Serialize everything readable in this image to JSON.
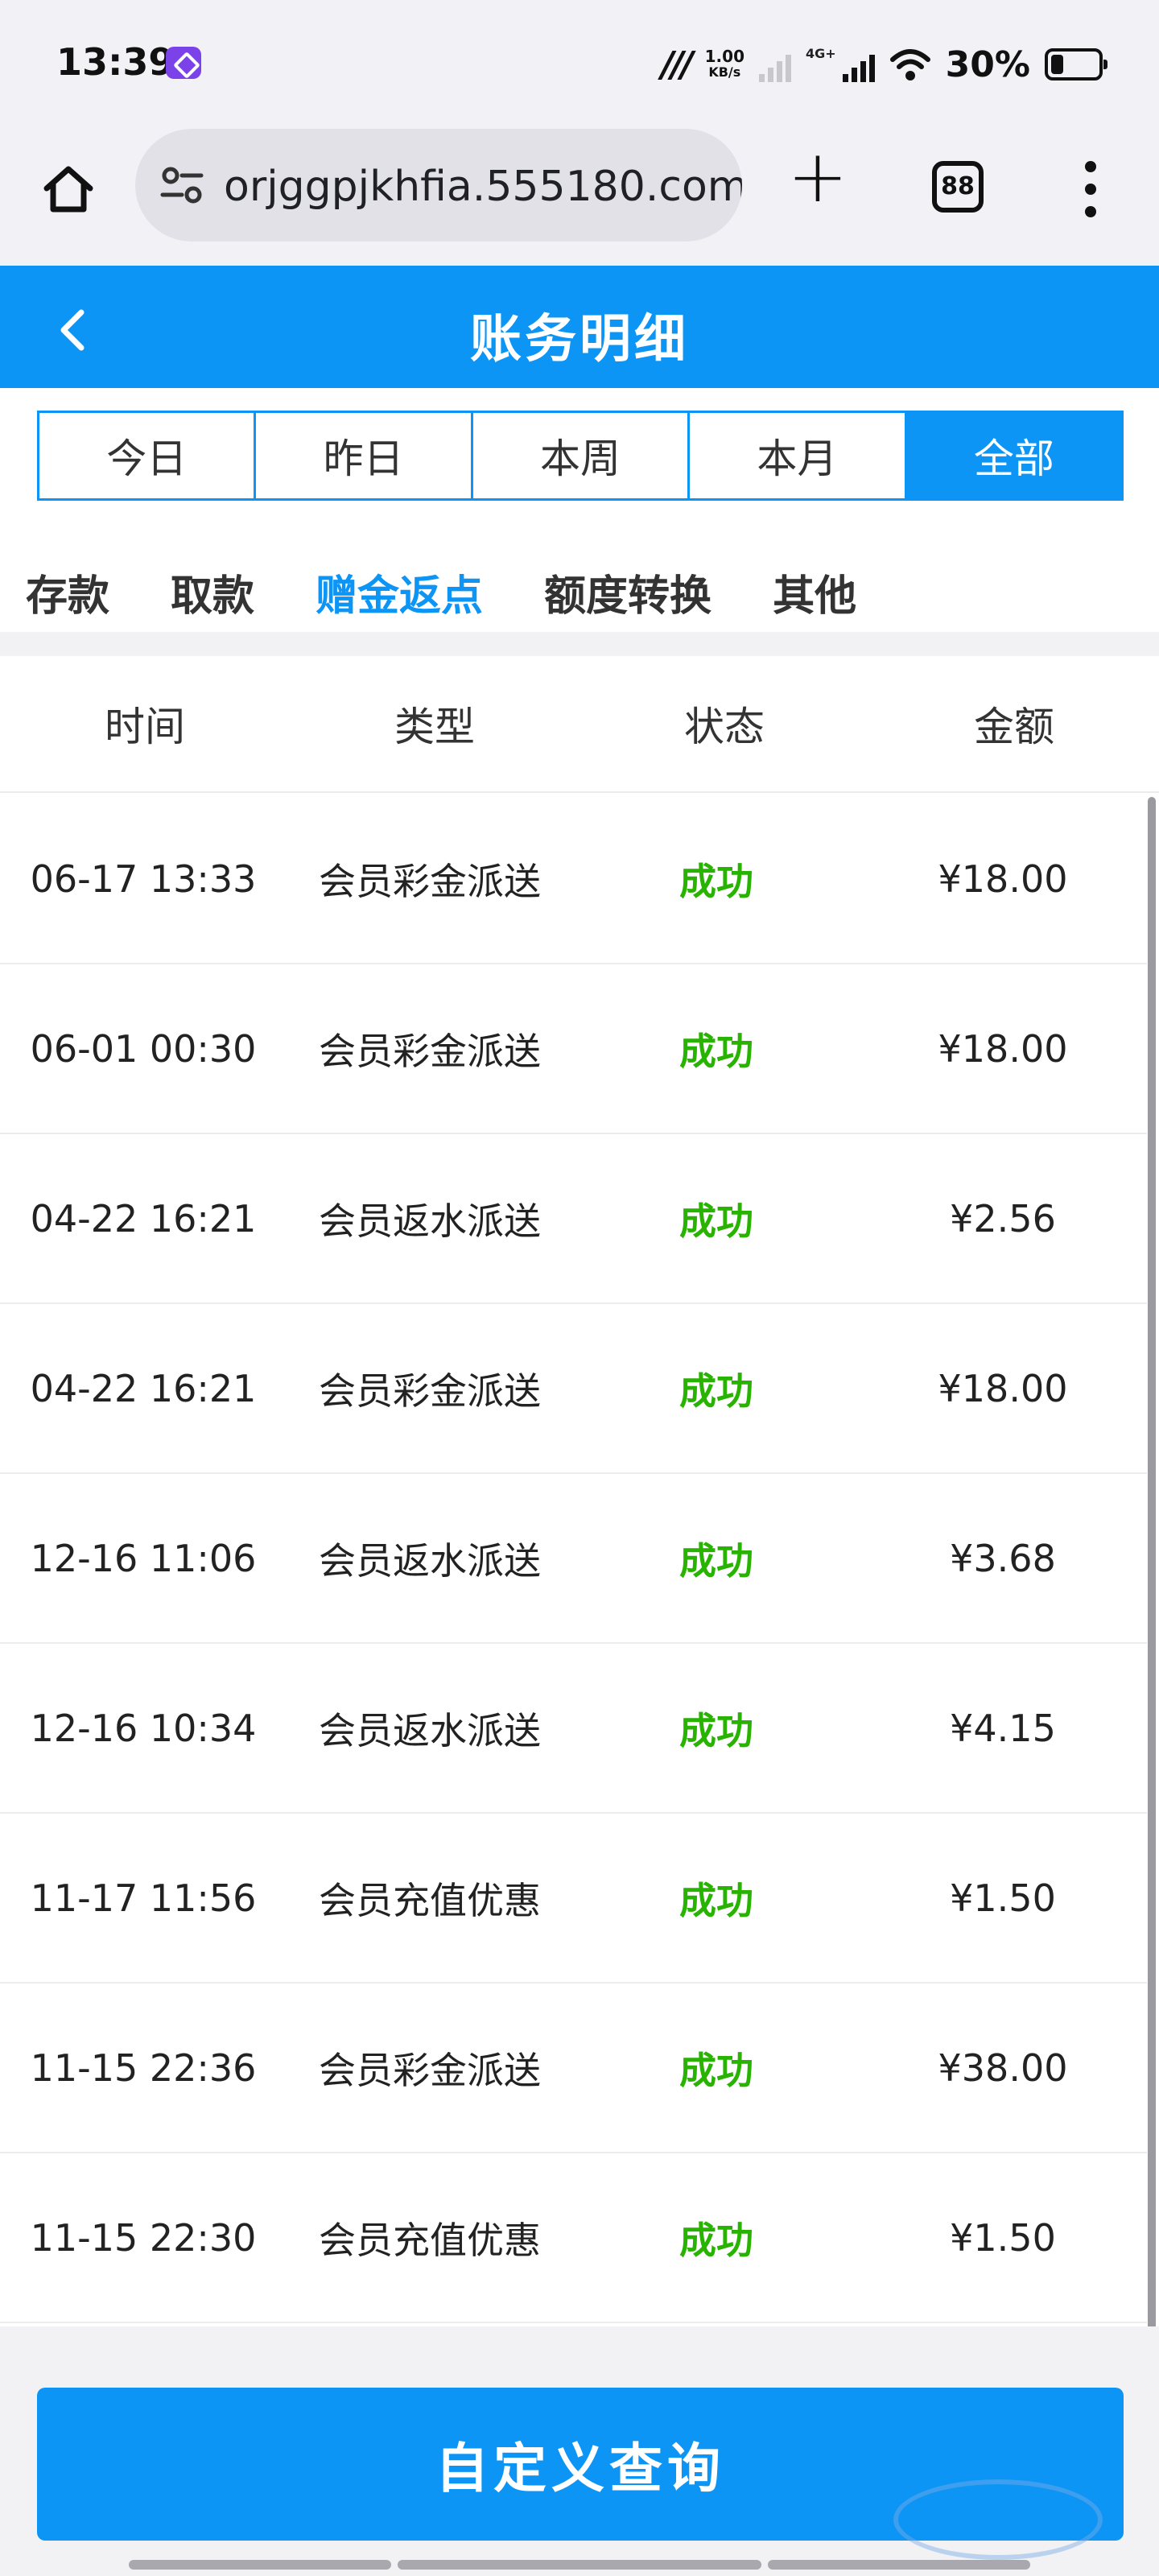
{
  "status_bar": {
    "time": "13:39",
    "app_icon": "shortcut-app-icon",
    "speed_value": "1.00",
    "speed_unit": "KB/s",
    "network_label": "4G+",
    "battery_text": "30%",
    "battery_level": 0.3
  },
  "browser": {
    "url": "orjggpjkhfia.555180.com",
    "tab_count": "88"
  },
  "header": {
    "title": "账务明细"
  },
  "period_tabs": [
    {
      "label": "今日",
      "active": false
    },
    {
      "label": "昨日",
      "active": false
    },
    {
      "label": "本周",
      "active": false
    },
    {
      "label": "本月",
      "active": false
    },
    {
      "label": "全部",
      "active": true
    }
  ],
  "category_tabs": [
    {
      "label": "存款",
      "active": false
    },
    {
      "label": "取款",
      "active": false
    },
    {
      "label": "赠金返点",
      "active": true
    },
    {
      "label": "额度转换",
      "active": false
    },
    {
      "label": "其他",
      "active": false
    }
  ],
  "table": {
    "headers": [
      "时间",
      "类型",
      "状态",
      "金额"
    ],
    "rows": [
      {
        "time": "06-17 13:33",
        "type": "会员彩金派送",
        "status": "成功",
        "amount": "¥18.00"
      },
      {
        "time": "06-01 00:30",
        "type": "会员彩金派送",
        "status": "成功",
        "amount": "¥18.00"
      },
      {
        "time": "04-22 16:21",
        "type": "会员返水派送",
        "status": "成功",
        "amount": "¥2.56"
      },
      {
        "time": "04-22 16:21",
        "type": "会员彩金派送",
        "status": "成功",
        "amount": "¥18.00"
      },
      {
        "time": "12-16 11:06",
        "type": "会员返水派送",
        "status": "成功",
        "amount": "¥3.68"
      },
      {
        "time": "12-16 10:34",
        "type": "会员返水派送",
        "status": "成功",
        "amount": "¥4.15"
      },
      {
        "time": "11-17 11:56",
        "type": "会员充值优惠",
        "status": "成功",
        "amount": "¥1.50"
      },
      {
        "time": "11-15 22:36",
        "type": "会员彩金派送",
        "status": "成功",
        "amount": "¥38.00"
      },
      {
        "time": "11-15 22:30",
        "type": "会员充值优惠",
        "status": "成功",
        "amount": "¥1.50"
      }
    ]
  },
  "query_button": {
    "label": "自定义查询"
  },
  "colors": {
    "primary": "#0d95f5",
    "success": "#27b300",
    "page_bg": "#f2f2f4"
  }
}
